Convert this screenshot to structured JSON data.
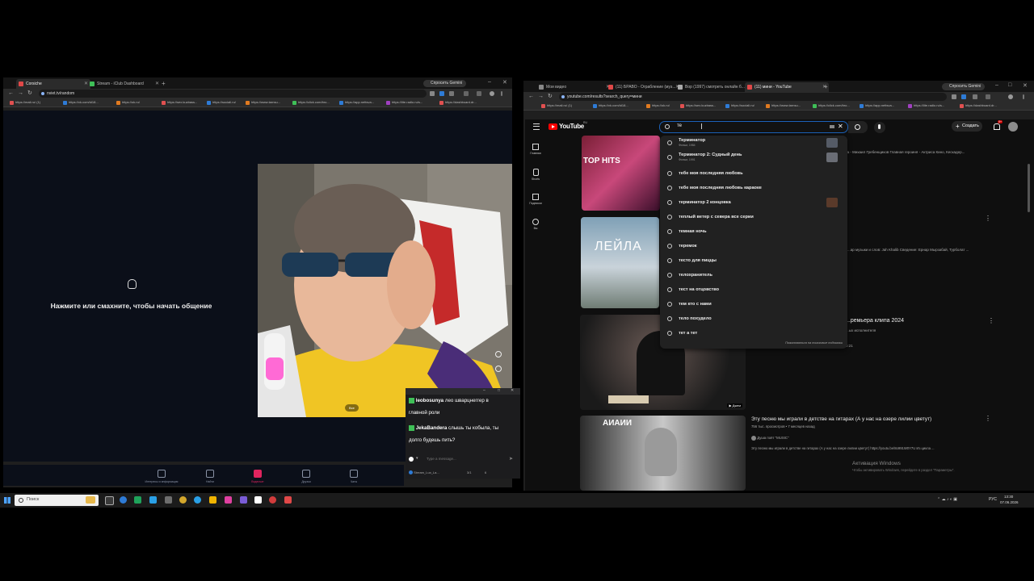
{
  "left_browser": {
    "tabs": [
      {
        "label": "Corsiche",
        "color": "#e04848"
      },
      {
        "label": "Stream - iClub Dashboard",
        "color": "#3fbf57"
      }
    ],
    "gemini_label": "Спросить Gemini",
    "url": "nviet.tv/random",
    "bookmarks": [
      "https://mail.ru/ (1)",
      "https://vk.com/id18...",
      "https://ok.ru/",
      "https://sex.kuzbass...",
      "https://sociali.ru/",
      "https://www.tarnsu...",
      "https://click.com/bro...",
      "https://app.nettsva...",
      "https://lite.radio.ru/s...",
      "https://dashboard.dr..."
    ]
  },
  "videochat": {
    "prompt": "Нажмите или смахните, чтобы начать общение",
    "nav": [
      "Интересы и информация",
      "Найти",
      "Видеочат",
      "Друзья",
      "Чаты"
    ],
    "cam_badge_text": "Все",
    "cam_badge_sub": "НАЗВАНИЕ"
  },
  "chat_overlay": {
    "messages": [
      {
        "user": "leobosunya",
        "text": "лео шварцнеггер в главной роли",
        "badge_color": "#3fbf57"
      },
      {
        "user": "JekaBandera",
        "text": "слышь ты кобыла, ты долго будешь пить?",
        "badge_color": "#3fbf57"
      }
    ],
    "input_placeholder": "Type a message...",
    "footer_user": "Stream_Lux_La...",
    "footer_count_a": "3/1",
    "footer_count_b": "6"
  },
  "right_browser": {
    "tabs": [
      {
        "label": "Мои видео",
        "color": "#888888"
      },
      {
        "label": "(11) БРАВО - Ограбление (муз...",
        "color": "#e04848"
      },
      {
        "label": "Вор (1997) смотреть онлайн б...",
        "color": "#aaaaaa"
      },
      {
        "label": "(11) мини - YouTube",
        "color": "#e04848"
      }
    ],
    "gemini_label": "Спросить Gemini",
    "url": "youtube.com/results?search_query=мини",
    "bookmarks": [
      "https://mail.ru/ (1)",
      "https://vk.com/id18...",
      "https://ok.ru/",
      "https://sex.kuzbass...",
      "https://sociali.ru/",
      "https://www.tarnsu...",
      "https://click.com/bro...",
      "https://app.nettsva...",
      "https://lite.radio.ru/s...",
      "https://dashboard.dr..."
    ]
  },
  "youtube": {
    "logo": "YouTube",
    "logo_sup": "RU",
    "search_value": "те",
    "create_label": "Создать",
    "notif_count": "9+",
    "sidebar": [
      "Главная",
      "Shorts",
      "Подписки",
      "Вы"
    ],
    "suggestions": [
      {
        "text": "Терминатор",
        "sub": "Фильм, 1984",
        "thumb": "#555b66"
      },
      {
        "text": "Терминатор 2: Судный день",
        "sub": "Фильм, 1991",
        "thumb": "#6a6d75"
      },
      {
        "text": "тебе моя последняя любовь",
        "sub": "",
        "thumb": ""
      },
      {
        "text": "тебе моя последняя любовь караоке",
        "sub": "",
        "thumb": ""
      },
      {
        "text": "терминатор 2 концовка",
        "sub": "",
        "thumb": "#5a3a2a"
      },
      {
        "text": "теплый ветер с севера все серии",
        "sub": "",
        "thumb": ""
      },
      {
        "text": "темная ночь",
        "sub": "",
        "thumb": ""
      },
      {
        "text": "теремок",
        "sub": "",
        "thumb": ""
      },
      {
        "text": "тесто для пиццы",
        "sub": "",
        "thumb": ""
      },
      {
        "text": "телохранитель",
        "sub": "",
        "thumb": ""
      },
      {
        "text": "тест на отцовство",
        "sub": "",
        "thumb": ""
      },
      {
        "text": "тем кто с нами",
        "sub": "",
        "thumb": ""
      },
      {
        "text": "тело похудело",
        "sub": "",
        "thumb": ""
      },
      {
        "text": "тет а тет",
        "sub": "",
        "thumb": ""
      }
    ],
    "report_link": "Пожаловаться на поисковые подсказки",
    "video1_meta": "...ова - Михаил Гребенщиков Главная героиня - Актриса Кино, Кескадер...",
    "video1_thumb_text": "TOP HITS",
    "video2_meta": "...ар музыки и слов: Jah Khalib Сведение: Ернар Мырзабай, Турболат ...",
    "video2_thumb_text": "ЛЕЙЛА",
    "video3_title": "...ремьера клипа 2024",
    "video3_channel": "...ых исполнителя",
    "video3_duration": "0:21",
    "video3_badge": "Джем",
    "video4_title": "Эту песню мы играли в детстве на гитарах (А у нас на озере лилии цветут)",
    "video4_views": "756 тыс. просмотров • 7 месяцев назад",
    "video4_channel": "Душа поёт \"MUSIC\"",
    "video4_desc": "Эту песню мы играли в детстве на гитарах (А у нас на озере лилии цветут) https://youtu.be/8o991W0Y7U Из цикла ...",
    "video4_thumb_text": "АИАИИ",
    "watermark_title": "Активация Windows",
    "watermark_sub": "Чтобы активировать Windows, перейдите в раздел \"Параметры\"."
  },
  "taskbar": {
    "search_placeholder": "Поиск",
    "lang": "РУС",
    "time": "13:30",
    "date": "07.06.2026",
    "apps": [
      "#3a3a3a",
      "#2e7bd6",
      "#1fa35b",
      "#2aa0e6",
      "#6e6e6e",
      "#d4a72c",
      "#2e7bd6",
      "#2b6fd6",
      "#2aa0e6",
      "#f0b400",
      "#e040a0",
      "#d23c3c",
      "#7a5cd6",
      "#c93a3a",
      "#ffffff",
      "#d23c3c",
      "#e04848"
    ]
  },
  "colors": {
    "youtube_red": "#ff0000",
    "twitch_green": "#3fbf57",
    "accent": "#e0245e"
  }
}
